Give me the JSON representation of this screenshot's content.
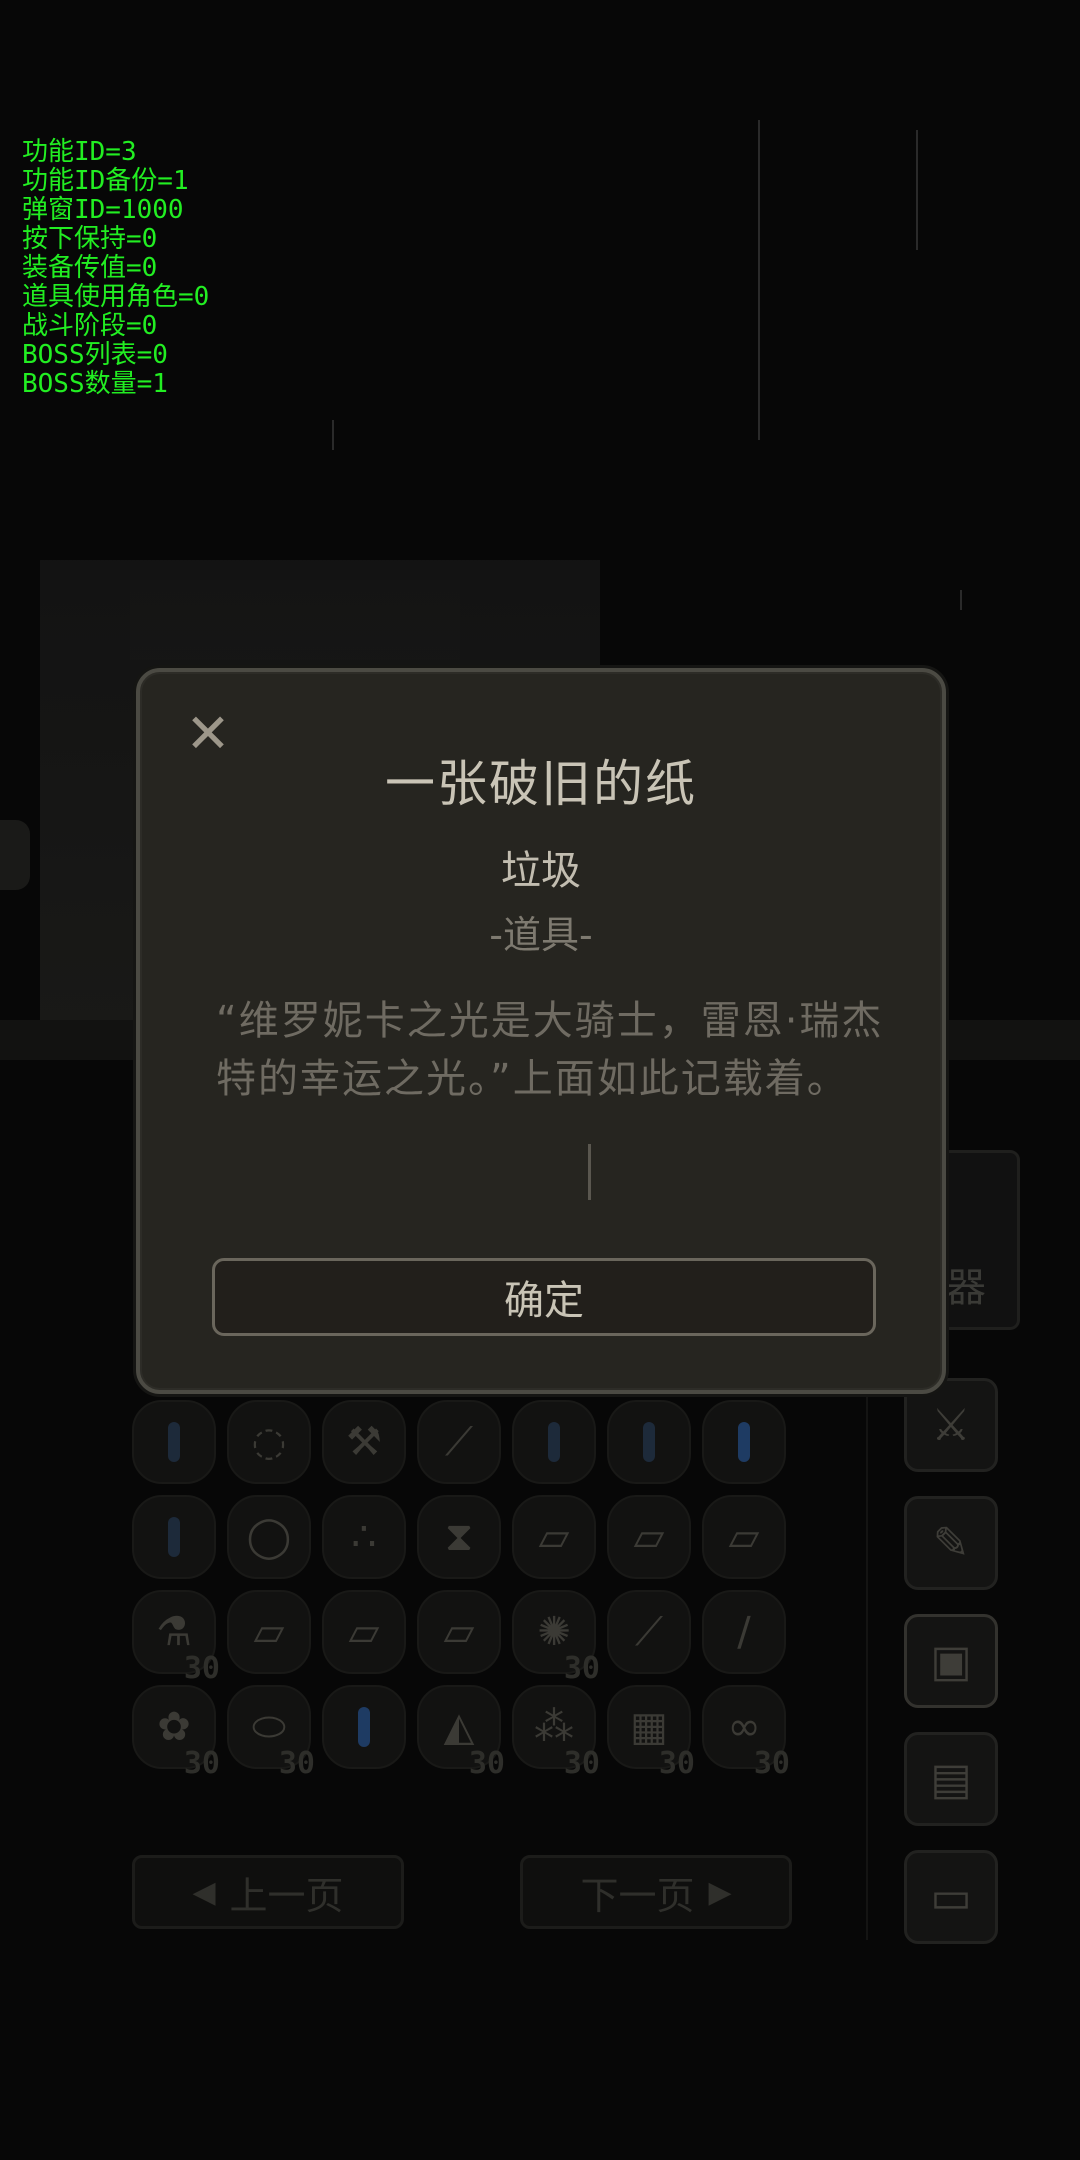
{
  "debug": [
    "功能ID=3",
    "功能ID备份=1",
    "弹窗ID=1000",
    "按下保持=0",
    "装备传值=0",
    "道具使用角色=0",
    "战斗阶段=0",
    "BOSS列表=0",
    "BOSS数量=1"
  ],
  "modal": {
    "close_icon": "✕",
    "title": "一张破旧的纸",
    "rarity": "垃圾",
    "type": "-道具-",
    "description": "“维罗妮卡之光是大骑士，雷恩·瑞杰特的幸运之光。”上面如此记载着。",
    "confirm_label": "确定"
  },
  "inventory": {
    "rows": [
      [
        {
          "icon": "gem"
        },
        {
          "icon": "necklace"
        },
        {
          "icon": "mace"
        },
        {
          "icon": "sword"
        },
        {
          "icon": "gem"
        },
        {
          "icon": "gem"
        },
        {
          "icon": "gem-blue"
        }
      ],
      [
        {
          "icon": "gem"
        },
        {
          "icon": "ring"
        },
        {
          "icon": "orbs"
        },
        {
          "icon": "hourglass"
        },
        {
          "icon": "scroll"
        },
        {
          "icon": "scroll"
        },
        {
          "icon": "scroll"
        }
      ],
      [
        {
          "icon": "potion",
          "count": "30"
        },
        {
          "icon": "scroll"
        },
        {
          "icon": "scroll"
        },
        {
          "icon": "scroll"
        },
        {
          "icon": "hedgehog",
          "count": "30"
        },
        {
          "icon": "sword"
        },
        {
          "icon": "knife"
        }
      ],
      [
        {
          "icon": "herb",
          "count": "30"
        },
        {
          "icon": "bread",
          "count": "30"
        },
        {
          "icon": "gem-blue"
        },
        {
          "icon": "cake",
          "count": "30"
        },
        {
          "icon": "stones",
          "count": "30"
        },
        {
          "icon": "cloth",
          "count": "30"
        },
        {
          "icon": "pretzel",
          "count": "30"
        }
      ]
    ]
  },
  "pagination": {
    "prev_label": "上一页",
    "next_label": "下一页"
  },
  "side_panel": {
    "weapon_label": "器"
  }
}
